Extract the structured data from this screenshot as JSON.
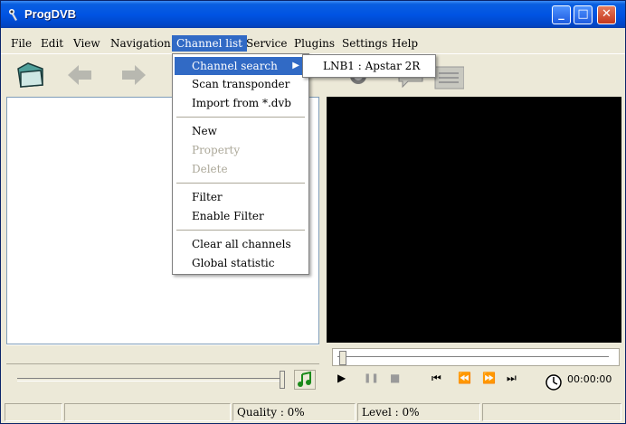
{
  "window": {
    "title": "ProgDVB",
    "minimize_label": "_",
    "maximize_label": "□",
    "close_label": "✕"
  },
  "menubar": {
    "items": [
      {
        "label": "File"
      },
      {
        "label": "Edit"
      },
      {
        "label": "View"
      },
      {
        "label": "Navigation"
      },
      {
        "label": "Channel list"
      },
      {
        "label": "Service"
      },
      {
        "label": "Plugins"
      },
      {
        "label": "Settings"
      },
      {
        "label": "Help"
      }
    ]
  },
  "channel_menu": {
    "items": [
      {
        "label": "Channel search"
      },
      {
        "label": "Scan transponder"
      },
      {
        "label": "Import from *.dvb"
      },
      {
        "label": "New"
      },
      {
        "label": "Property"
      },
      {
        "label": "Delete"
      },
      {
        "label": "Filter"
      },
      {
        "label": "Enable Filter"
      },
      {
        "label": "Clear all channels"
      },
      {
        "label": "Global statistic"
      }
    ],
    "submenu_arrow": "▶"
  },
  "submenu": {
    "items": [
      {
        "label": "LNB1 : Apstar 2R"
      }
    ]
  },
  "player": {
    "time": "00:00:00",
    "play": "▶",
    "pause": "❚❚",
    "stop": "■",
    "prev": "⏮",
    "rew": "⏪",
    "ffw": "⏩",
    "next": "⏭"
  },
  "status": {
    "quality": "Quality : 0%",
    "level": "Level : 0%"
  },
  "colors": {
    "titlebar": "#0054e3",
    "menu_highlight": "#316ac5",
    "window_bg": "#ece9d8",
    "video_bg": "#000000"
  },
  "icons": [
    "program-icon",
    "folder-open-icon",
    "back-icon",
    "forward-icon",
    "note-icon",
    "clock-icon"
  ]
}
